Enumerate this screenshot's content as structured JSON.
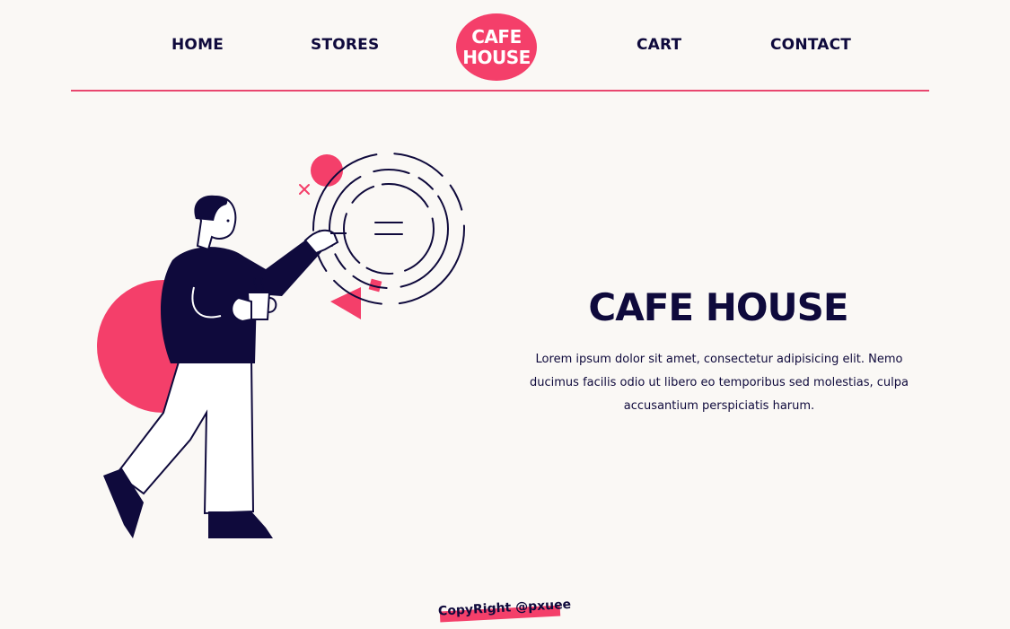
{
  "nav": {
    "home": "HOME",
    "stores": "STORES",
    "cart": "CART",
    "contact": "CONTACT"
  },
  "logo": {
    "line1": "CAFE",
    "line2": "HOUSE"
  },
  "hero": {
    "title": "CAFE HOUSE",
    "text": "Lorem ipsum dolor sit amet, consectetur adipisicing elit. Nemo ducimus facilis odio ut libero eo temporibus sed molestias, culpa accusantium perspiciatis harum."
  },
  "footer": {
    "copyright": "CopyRight @pxuee"
  },
  "colors": {
    "accent": "#f43f6a",
    "ink": "#0f0a3c",
    "background": "#faf8f5"
  },
  "illustration": {
    "icon": "person-with-coffee-illustration"
  }
}
